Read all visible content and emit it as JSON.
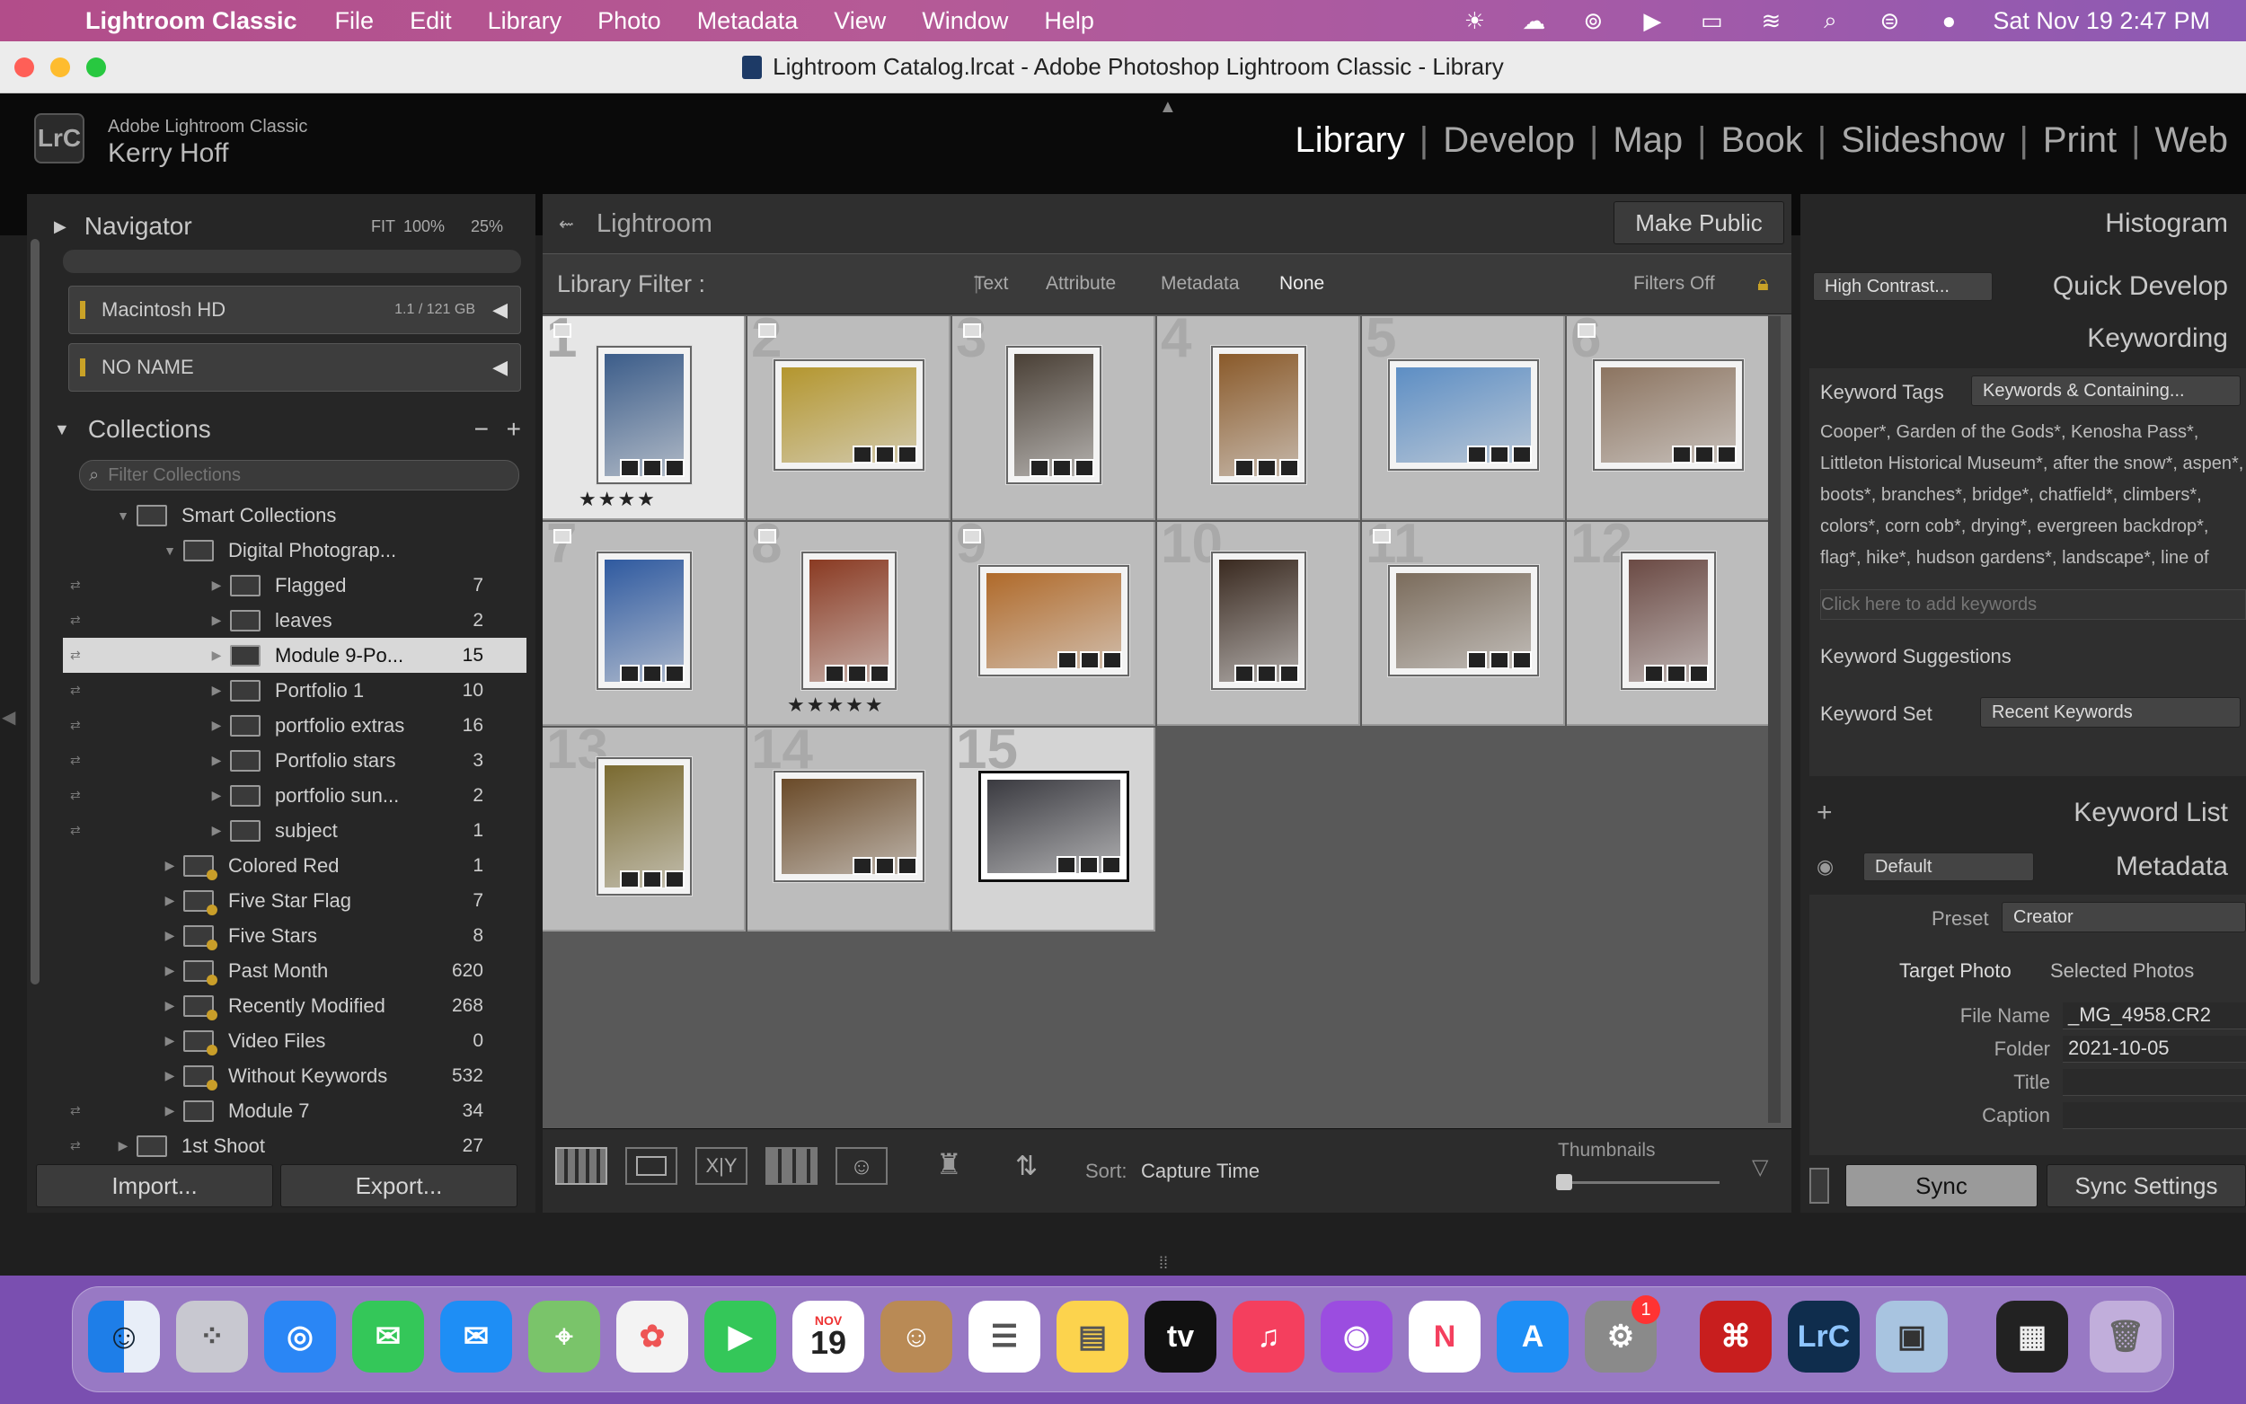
{
  "menubar": {
    "app": "Lightroom Classic",
    "items": [
      "File",
      "Edit",
      "Library",
      "Photo",
      "Metadata",
      "View",
      "Window",
      "Help"
    ],
    "datetime": "Sat Nov 19  2:47 PM"
  },
  "window": {
    "title": "Lightroom Catalog.lrcat - Adobe Photoshop Lightroom Classic - Library"
  },
  "identity": {
    "app": "Adobe Lightroom Classic",
    "user": "Kerry Hoff",
    "logo": "LrC"
  },
  "modules": [
    "Library",
    "Develop",
    "Map",
    "Book",
    "Slideshow",
    "Print",
    "Web"
  ],
  "left": {
    "navigator": {
      "title": "Navigator",
      "zoom": [
        "FIT",
        "100%",
        "25%"
      ]
    },
    "volumes": [
      {
        "name": "Macintosh HD",
        "space": "1.1 / 121 GB"
      },
      {
        "name": "NO NAME",
        "space": ""
      }
    ],
    "collections": {
      "title": "Collections",
      "filter_placeholder": "Filter Collections",
      "rows": [
        {
          "name": "Smart Collections",
          "count": "",
          "indent": 1,
          "type": "set"
        },
        {
          "name": "Digital Photograp...",
          "count": "",
          "indent": 2,
          "type": "set"
        },
        {
          "name": "Flagged",
          "count": "7",
          "indent": 3,
          "type": "col"
        },
        {
          "name": "leaves",
          "count": "2",
          "indent": 3,
          "type": "col"
        },
        {
          "name": "Module 9-Po...",
          "count": "15",
          "indent": 3,
          "type": "col",
          "selected": true
        },
        {
          "name": "Portfolio 1",
          "count": "10",
          "indent": 3,
          "type": "col"
        },
        {
          "name": "portfolio extras",
          "count": "16",
          "indent": 3,
          "type": "col"
        },
        {
          "name": "Portfolio stars",
          "count": "3",
          "indent": 3,
          "type": "col"
        },
        {
          "name": "portfolio sun...",
          "count": "2",
          "indent": 3,
          "type": "col"
        },
        {
          "name": "subject",
          "count": "1",
          "indent": 3,
          "type": "col"
        },
        {
          "name": "Colored Red",
          "count": "1",
          "indent": 2,
          "type": "smart"
        },
        {
          "name": "Five Star Flag",
          "count": "7",
          "indent": 2,
          "type": "smart"
        },
        {
          "name": "Five Stars",
          "count": "8",
          "indent": 2,
          "type": "smart"
        },
        {
          "name": "Past Month",
          "count": "620",
          "indent": 2,
          "type": "smart"
        },
        {
          "name": "Recently Modified",
          "count": "268",
          "indent": 2,
          "type": "smart"
        },
        {
          "name": "Video Files",
          "count": "0",
          "indent": 2,
          "type": "smart"
        },
        {
          "name": "Without Keywords",
          "count": "532",
          "indent": 2,
          "type": "smart"
        },
        {
          "name": "Module 7",
          "count": "34",
          "indent": 2,
          "type": "col"
        },
        {
          "name": "1st Shoot",
          "count": "27",
          "indent": 1,
          "type": "col"
        }
      ]
    },
    "import": "Import...",
    "export": "Export..."
  },
  "center": {
    "source": "Lightroom",
    "make_public": "Make Public",
    "filter": {
      "label": "Library Filter :",
      "tabs": [
        "Text",
        "Attribute",
        "Metadata",
        "None"
      ],
      "status": "Filters Off"
    },
    "thumbs": [
      {
        "n": "1",
        "stars": "★★★★",
        "color": "#3c5d8a",
        "orient": "v"
      },
      {
        "n": "2",
        "stars": "",
        "color": "#b4962e",
        "orient": "h"
      },
      {
        "n": "3",
        "stars": "",
        "color": "#4a4036",
        "orient": "v"
      },
      {
        "n": "4",
        "stars": "",
        "color": "#8a5a2a",
        "orient": "v"
      },
      {
        "n": "5",
        "stars": "",
        "color": "#5d8ec4",
        "orient": "h"
      },
      {
        "n": "6",
        "stars": "",
        "color": "#8c7460",
        "orient": "h"
      },
      {
        "n": "7",
        "stars": "",
        "color": "#2f5aa0",
        "orient": "v"
      },
      {
        "n": "8",
        "stars": "★★★★★",
        "color": "#8a3a22",
        "orient": "v"
      },
      {
        "n": "9",
        "stars": "",
        "color": "#b06a2a",
        "orient": "h"
      },
      {
        "n": "10",
        "stars": "",
        "color": "#3a2a20",
        "orient": "v"
      },
      {
        "n": "11",
        "stars": "",
        "color": "#7b6c5c",
        "orient": "h"
      },
      {
        "n": "12",
        "stars": "",
        "color": "#6b4a44",
        "orient": "v"
      },
      {
        "n": "13",
        "stars": "",
        "color": "#7a6a30",
        "orient": "v"
      },
      {
        "n": "14",
        "stars": "",
        "color": "#6a4a28",
        "orient": "h"
      },
      {
        "n": "15",
        "stars": "",
        "color": "#3a3a40",
        "orient": "h"
      }
    ],
    "toolbar": {
      "sort_label": "Sort:",
      "sort_value": "Capture Time",
      "thumbs_label": "Thumbnails"
    }
  },
  "right": {
    "histogram": "Histogram",
    "quick_develop": {
      "title": "Quick Develop",
      "preset": "High Contrast..."
    },
    "keywording": {
      "title": "Keywording",
      "tags_label": "Keyword Tags",
      "tags_mode": "Keywords & Containing...",
      "text": "Cooper*, Garden of the Gods*, Kenosha Pass*, Littleton Historical Museum*, after the snow*, aspen*, boots*, branches*, bridge*, chatfield*, climbers*, colors*, corn cob*, drying*, evergreen backdrop*, flag*, hike*, hudson gardens*, landscape*, line of yellow*, line*, milk jugs*, mountains*, proportion*, rock frame*, rock*, rocks*,",
      "add_placeholder": "Click here to add keywords",
      "suggestions": "Keyword Suggestions",
      "set_label": "Keyword Set",
      "set_value": "Recent Keywords"
    },
    "keyword_list": "Keyword List",
    "metadata": {
      "title": "Metadata",
      "preset_default": "Default",
      "preset_label": "Preset",
      "preset_value": "Creator",
      "tab_target": "Target Photo",
      "tab_selected": "Selected Photos",
      "fields": [
        {
          "label": "File Name",
          "value": "_MG_4958.CR2"
        },
        {
          "label": "Folder",
          "value": "2021-10-05"
        },
        {
          "label": "Title",
          "value": ""
        },
        {
          "label": "Caption",
          "value": ""
        }
      ]
    },
    "sync": "Sync",
    "sync_settings": "Sync Settings"
  },
  "dock": {
    "calendar_month": "NOV",
    "calendar_day": "19",
    "badge": "1",
    "lrc": "LrC"
  }
}
